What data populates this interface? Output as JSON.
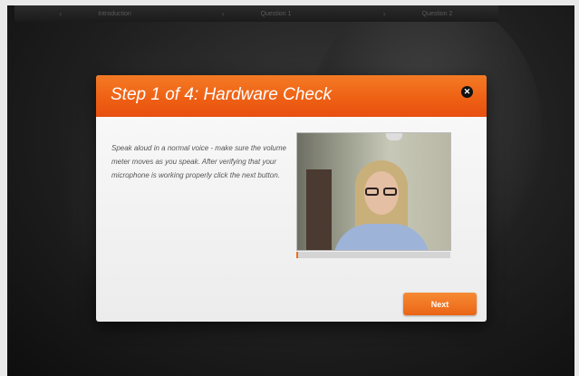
{
  "nav": {
    "steps": [
      "Introduction",
      "Question 1",
      "Question 2"
    ]
  },
  "modal": {
    "title": "Step 1 of 4: Hardware Check",
    "close_icon": "close-icon",
    "close_glyph": "✕",
    "instructions": "Speak aloud in a normal voice - make sure the volume meter moves as you speak. After verifying that your microphone is working properly click the next button.",
    "volume_level": 0.01,
    "next_label": "Next"
  },
  "colors": {
    "accent": "#ee6318",
    "overlay": "#1f1f1f"
  }
}
